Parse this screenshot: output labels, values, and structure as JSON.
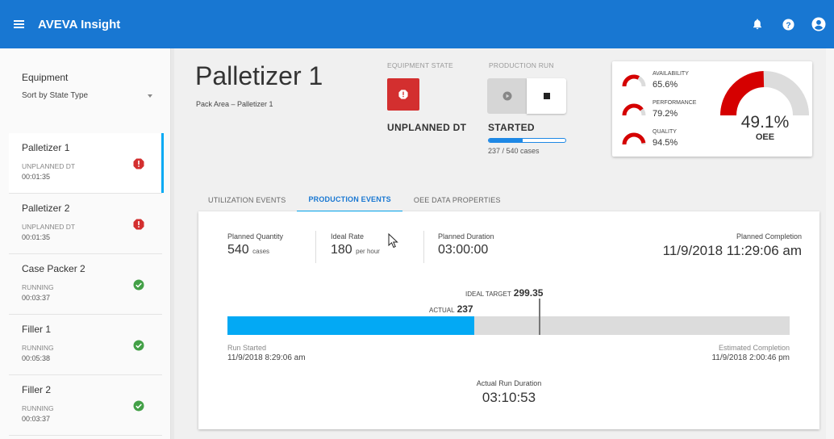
{
  "app": {
    "title": "AVEVA Insight"
  },
  "topbar": {
    "icons": [
      "menu-icon",
      "bell-icon",
      "help-icon",
      "account-icon"
    ]
  },
  "sidebar": {
    "header": "Equipment",
    "sort_label": "Sort by State Type",
    "items": [
      {
        "name": "Palletizer 1",
        "state": "UNPLANNED DT",
        "time": "00:01:35",
        "status": "alert"
      },
      {
        "name": "Palletizer 2",
        "state": "UNPLANNED DT",
        "time": "00:01:35",
        "status": "alert"
      },
      {
        "name": "Case Packer 2",
        "state": "RUNNING",
        "time": "00:03:37",
        "status": "ok"
      },
      {
        "name": "Filler 1",
        "state": "RUNNING",
        "time": "00:05:38",
        "status": "ok"
      },
      {
        "name": "Filler 2",
        "state": "RUNNING",
        "time": "00:03:37",
        "status": "ok"
      }
    ]
  },
  "equipment": {
    "title": "Palletizer 1",
    "subtitle": "Pack Area – Palletizer 1",
    "state_label": "EQUIPMENT STATE",
    "state_value": "UNPLANNED DT",
    "run_label": "PRODUCTION RUN",
    "run_value": "STARTED",
    "run_count": "237 / 540 cases",
    "run_progress_fraction": 0.439
  },
  "oee": {
    "availability_label": "AVAILABILITY",
    "availability_value": "65.6%",
    "performance_label": "PERFORMANCE",
    "performance_value": "79.2%",
    "quality_label": "QUALITY",
    "quality_value": "94.5%",
    "oee_value": "49.1%",
    "oee_label": "OEE",
    "oee_fraction": 0.491,
    "colors": {
      "gauge": "#d50000",
      "track": "#dcdcdc"
    }
  },
  "tabs": [
    {
      "label": "UTILIZATION EVENTS",
      "active": false
    },
    {
      "label": "PRODUCTION EVENTS",
      "active": true
    },
    {
      "label": "OEE DATA PROPERTIES",
      "active": false
    }
  ],
  "production": {
    "planned_qty_label": "Planned Quantity",
    "planned_qty_value": "540",
    "planned_qty_unit": "cases",
    "ideal_rate_label": "Ideal Rate",
    "ideal_rate_value": "180",
    "ideal_rate_unit": "per hour",
    "planned_duration_label": "Planned Duration",
    "planned_duration_value": "03:00:00",
    "planned_completion_label": "Planned Completion",
    "planned_completion_value": "11/9/2018 11:29:06 am",
    "ideal_target_label": "IDEAL TARGET",
    "ideal_target_value": "299.35",
    "actual_label": "ACTUAL",
    "actual_value": "237",
    "actual_fraction": 0.439,
    "run_started_label": "Run Started",
    "run_started_value": "11/9/2018 8:29:06 am",
    "est_completion_label": "Estimated Completion",
    "est_completion_value": "11/9/2018 2:00:46 pm",
    "actual_duration_label": "Actual Run Duration",
    "actual_duration_value": "03:10:53"
  },
  "colors": {
    "brand": "#1877d2",
    "accent": "#03a9f4",
    "alert": "#d32f2f",
    "ok": "#43a047"
  }
}
